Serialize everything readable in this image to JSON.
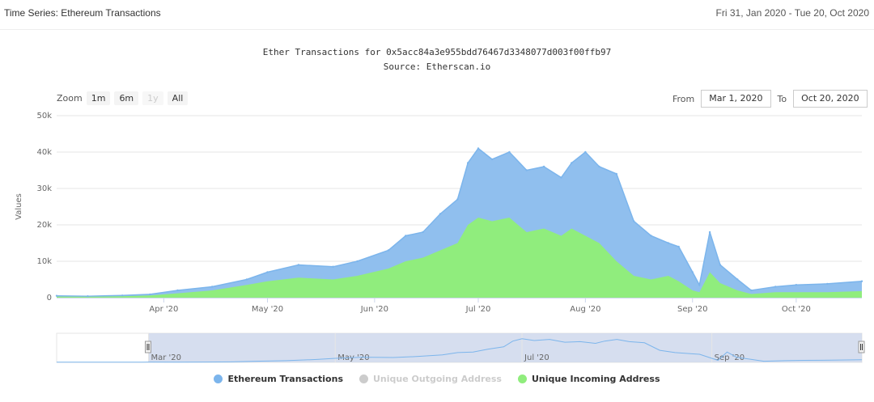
{
  "header": {
    "title": "Time Series: Ethereum Transactions",
    "range": "Fri 31, Jan 2020 - Tue 20, Oct 2020"
  },
  "chart": {
    "title": "Ether Transactions for 0x5acc84a3e955bdd76467d3348077d003f00ffb97",
    "subtitle": "Source: Etherscan.io"
  },
  "zoom": {
    "label": "Zoom",
    "buttons": [
      "1m",
      "6m",
      "1y",
      "All"
    ],
    "disabled": [
      "1y"
    ]
  },
  "range_selector": {
    "from_label": "From",
    "from_value": "Mar 1, 2020",
    "to_label": "To",
    "to_value": "Oct 20, 2020"
  },
  "colors": {
    "transactions": "#90bfee",
    "transactions_line": "#7cb5ec",
    "incoming": "#90ed7d",
    "outgoing": "#cccccc",
    "navigator_mask": "#ccd6eb"
  },
  "chart_data": {
    "type": "area",
    "ylabel": "Values",
    "ylim": [
      0,
      50000
    ],
    "yticks": [
      0,
      10000,
      20000,
      30000,
      40000,
      50000
    ],
    "ytick_labels": [
      "0",
      "10k",
      "20k",
      "30k",
      "40k",
      "50k"
    ],
    "xlim": [
      "2020-03-01",
      "2020-10-20"
    ],
    "xticks": [
      {
        "date": "2020-04-01",
        "label": "Apr '20"
      },
      {
        "date": "2020-05-01",
        "label": "May '20"
      },
      {
        "date": "2020-06-01",
        "label": "Jun '20"
      },
      {
        "date": "2020-07-01",
        "label": "Jul '20"
      },
      {
        "date": "2020-08-01",
        "label": "Aug '20"
      },
      {
        "date": "2020-09-01",
        "label": "Sep '20"
      },
      {
        "date": "2020-10-01",
        "label": "Oct '20"
      }
    ],
    "x": [
      "2020-03-01",
      "2020-03-10",
      "2020-03-20",
      "2020-03-28",
      "2020-04-05",
      "2020-04-15",
      "2020-04-25",
      "2020-05-01",
      "2020-05-10",
      "2020-05-20",
      "2020-05-27",
      "2020-06-05",
      "2020-06-10",
      "2020-06-15",
      "2020-06-20",
      "2020-06-25",
      "2020-06-28",
      "2020-07-01",
      "2020-07-05",
      "2020-07-10",
      "2020-07-15",
      "2020-07-20",
      "2020-07-25",
      "2020-07-28",
      "2020-08-01",
      "2020-08-05",
      "2020-08-10",
      "2020-08-15",
      "2020-08-20",
      "2020-08-25",
      "2020-08-28",
      "2020-09-01",
      "2020-09-03",
      "2020-09-06",
      "2020-09-09",
      "2020-09-14",
      "2020-09-18",
      "2020-09-25",
      "2020-10-01",
      "2020-10-10",
      "2020-10-20"
    ],
    "series": [
      {
        "name": "Ethereum Transactions",
        "values": [
          500,
          400,
          600,
          900,
          2000,
          3000,
          5000,
          7000,
          9000,
          8500,
          10000,
          13000,
          17000,
          18000,
          23000,
          27000,
          37000,
          41000,
          38000,
          40000,
          35000,
          36000,
          33000,
          37000,
          40000,
          36000,
          34000,
          21000,
          17000,
          15000,
          14000,
          7000,
          3500,
          18000,
          9000,
          5000,
          2000,
          3000,
          3500,
          3800,
          4500
        ]
      },
      {
        "name": "Unique Outgoing Address",
        "values": [],
        "hidden": true
      },
      {
        "name": "Unique Incoming Address",
        "values": [
          300,
          250,
          400,
          600,
          1200,
          2000,
          3500,
          4500,
          5500,
          5000,
          6000,
          8000,
          10000,
          11000,
          13000,
          15000,
          20000,
          22000,
          21000,
          22000,
          18000,
          19000,
          17000,
          19000,
          17000,
          15000,
          10000,
          6000,
          5000,
          6000,
          4500,
          2000,
          1500,
          7000,
          4000,
          2000,
          1000,
          1500,
          1500,
          1500,
          1800
        ]
      }
    ],
    "navigator": {
      "x_labels": [
        "Mar '20",
        "May '20",
        "Jul '20",
        "Sep '20"
      ],
      "selected_from": "2020-03-01",
      "selected_to": "2020-10-20"
    },
    "legend": {
      "position": "bottom-center"
    }
  }
}
